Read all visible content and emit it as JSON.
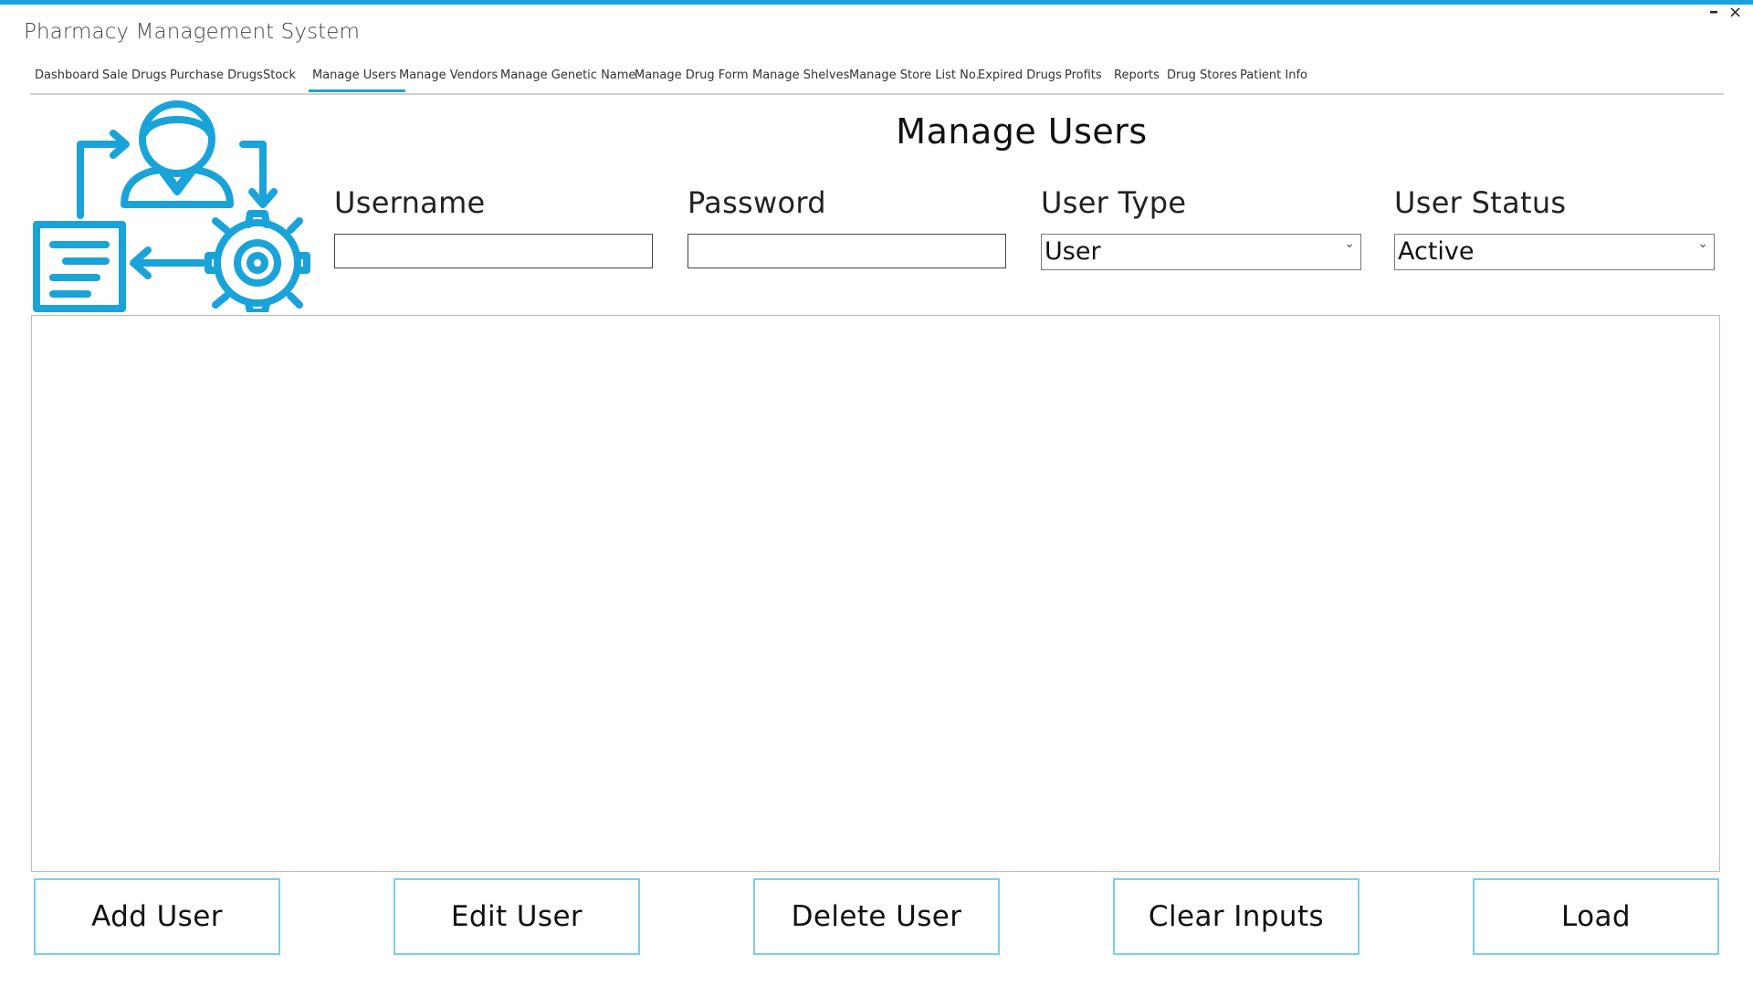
{
  "app": {
    "title": "Pharmacy Management System",
    "accent_color": "#1aa3d9",
    "minimize_icon": "–",
    "close_icon": "×"
  },
  "tabs": [
    {
      "label": "Dashboard"
    },
    {
      "label": "Sale Drugs"
    },
    {
      "label": "Purchase Drugs"
    },
    {
      "label": "Stock"
    },
    {
      "label": "Manage Users",
      "active": true
    },
    {
      "label": "Manage Vendors"
    },
    {
      "label": "Manage Genetic Name"
    },
    {
      "label": "Manage Drug Form"
    },
    {
      "label": "Manage Shelves"
    },
    {
      "label": "Manage Store List No."
    },
    {
      "label": "Expired Drugs"
    },
    {
      "label": "Profits"
    },
    {
      "label": "Reports"
    },
    {
      "label": "Drug Stores"
    },
    {
      "label": "Patient Info"
    }
  ],
  "page": {
    "title": "Manage Users",
    "logo_icon": "user-management-icon"
  },
  "form": {
    "username": {
      "label": "Username",
      "value": "",
      "placeholder": ""
    },
    "password": {
      "label": "Password",
      "value": "",
      "placeholder": ""
    },
    "user_type": {
      "label": "User Type",
      "selected": "User"
    },
    "user_status": {
      "label": "User Status",
      "selected": "Active"
    },
    "dropdown_icon": "⌄"
  },
  "actions": {
    "add": "Add User",
    "edit": "Edit User",
    "delete": "Delete User",
    "clear": "Clear Inputs",
    "load": "Load"
  }
}
